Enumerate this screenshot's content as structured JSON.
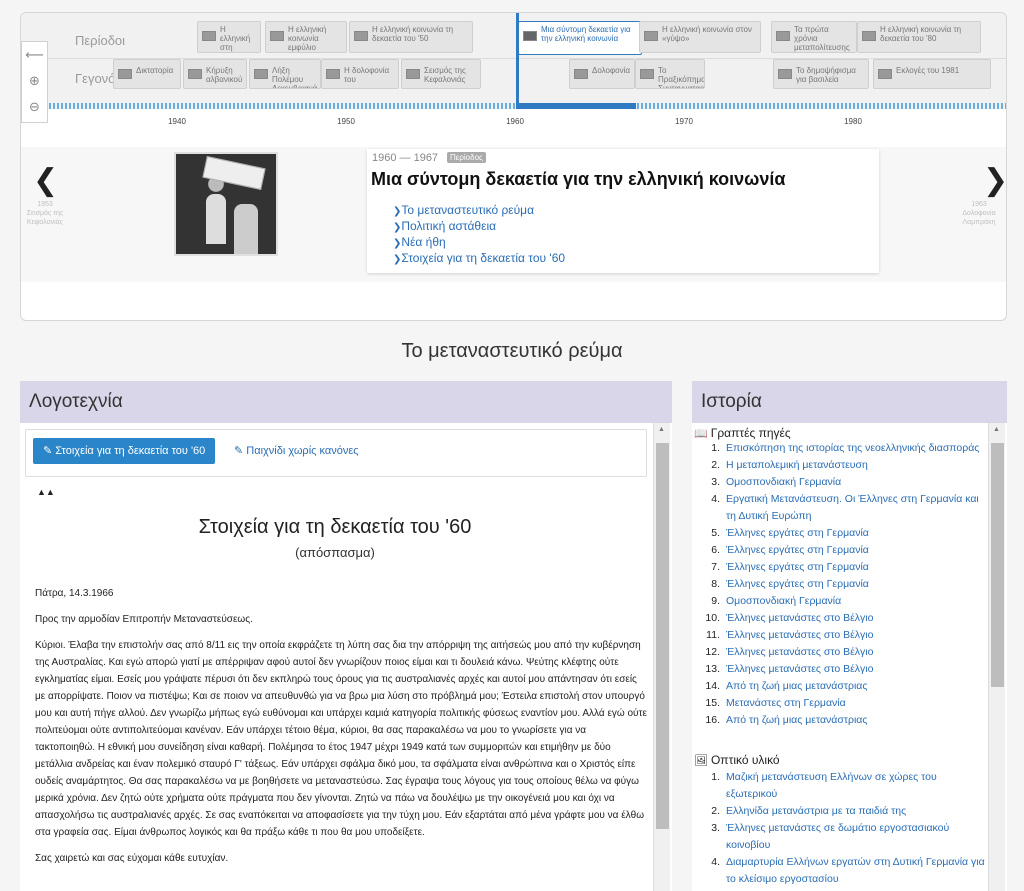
{
  "timeline": {
    "band_periods_label": "Περίοδοι",
    "band_events_label": "Γεγονό",
    "zoom_controls": [
      "back-arrow-icon",
      "zoom-in-icon",
      "zoom-out-icon"
    ],
    "period_items": [
      "Η ελληνική στη Γερμανία",
      "Η ελληνική κοινωνία εμφύλιο",
      "Η ελληνική κοινωνία τη δεκαετία του '50",
      "Μια σύντομη δεκαετία για την ελληνική κοινωνία",
      "Η ελληνική κοινωνία στον «γύψο»",
      "Τα πρώτα χρόνια μεταπολίτευσης",
      "Η ελληνική κοινωνία τη δεκαετία του '80"
    ],
    "event_items": [
      "Δικτατορία",
      "Κήρυξη αλβανικού",
      "Λήξη Πολέμου Δεκεμβριανά",
      "Η δολοφονία του",
      "Σεισμός της Κεφαλονιάς",
      "Δολοφονία",
      "Το Πραξικόπημα Συνταγματαρχών",
      "Το δημοψήφισμα για βασιλεία",
      "Εκλογές του 1981"
    ],
    "years": [
      "1940",
      "1950",
      "1960",
      "1970",
      "1980"
    ],
    "prev": {
      "year": "1953",
      "label": "Σεισμός της Κεφαλονιάς"
    },
    "next": {
      "year": "1963",
      "label": "Δολοφονία Λαμπράκη"
    },
    "active": {
      "period": "1960 — 1967",
      "badge": "Περίοδος",
      "title": "Μια σύντομη δεκαετία για την ελληνική κοινωνία",
      "links": [
        "Το μεταναστευτικό ρεύμα",
        "Πολιτική αστάθεια",
        "Νέα ήθη",
        "Στοιχεία για τη δεκαετία του '60"
      ]
    }
  },
  "section_title": "Το μεταναστευτικό ρεύμα",
  "literature": {
    "heading": "Λογοτεχνία",
    "primary_button": "Στοιχεία για τη δεκαετία του '60",
    "secondary_link": "Παιχνίδι χωρίς κανόνες",
    "doc_title": "Στοιχεία για τη δεκαετία του '60",
    "doc_subtitle": "(απόσπασμα)",
    "paragraphs": [
      "Πάτρα, 14.3.1966",
      "Προς την αρμοδίαν Επιτροπήν Μεταναστεύσεως.",
      "Κύριοι. Έλαβα την επιστολήν σας από 8/11 εις την οποία εκφράζετε τη λύπη σας δια την απόρριψη της αιτήσεώς μου από την κυβέρνηση της Αυστραλίας. Και εγώ απορώ γιατί με απέρριψαν αφού αυτοί δεν γνωρίζουν ποιος είμαι και τι δουλειά κάνω. Ψεύτης κλέφτης ούτε εγκληματίας είμαι. Εσείς μου γράψατε πέρυσι ότι δεν εκπληρώ τους όρους για τις αυστραλιανές αρχές και αυτοί μου απάντησαν ότι εσείς με απορρίψατε. Ποιον να πιστέψω; Και σε ποιον να απευθυνθώ για να βρω μια λύση στο πρόβλημά μου; Έστειλα επιστολή στον υπουργό μου και αυτή πήγε αλλού. Δεν γνωρίζω μήπως εγώ ευθύνομαι και υπάρχει καμιά κατηγορία πολιτικής φύσεως εναντίον μου. Αλλά εγώ ούτε πολιτεύομαι ούτε αντιπολιτεύομαι κανέναν. Εάν υπάρχει τέτοιο θέμα, κύριοι, θα σας παρακαλέσω να μου το γνωρίσετε για να τακτοποιηθώ. Η εθνική μου συνείδηση είναι καθαρή. Πολέμησα το έτος 1947 μέχρι 1949 κατά των συμμοριτών και ετιμήθην με δύο μετάλλια ανδρείας και έναν πολεμικό σταυρό Γ' τάξεως. Εάν υπάρχει σφάλμα δικό μου, τα σφάλματα είναι ανθρώπινα και ο Χριστός είπε ουδείς αναμάρτητος. Θα σας παρακαλέσω να με βοηθήσετε να μεταναστεύσω. Σας έγραψα τους λόγους για τους οποίους θέλω να φύγω μερικά χρόνια. Δεν ζητώ ούτε χρήματα ούτε πράγματα που δεν γίνονται. Ζητώ να πάω να δουλέψω με την οικογένειά μου και όχι να απασχολήσω τις αυστραλιανές αρχές. Σε σας εναπόκειται να αποφασίσετε για την τύχη μου. Εάν εξαρτάται από μένα γράφτε μου να έλθω στα γραφεία σας. Είμαι άνθρωπος λογικός και θα πράξω κάθε τι που θα μου υποδείξετε.",
      "Σας χαιρετώ και σας εύχομαι κάθε ευτυχίαν."
    ]
  },
  "history": {
    "heading": "Ιστορία",
    "written_heading": "Γραπτές πηγές",
    "written_sources": [
      "Επισκόπηση της ιστορίας της νεοελληνικής διασποράς",
      "Η μεταπολεμική μετανάστευση",
      "Ομοσπονδιακή Γερμανία",
      "Εργατική Μετανάστευση. Οι Έλληνες στη Γερμανία και τη Δυτική Ευρώπη",
      "Έλληνες εργάτες στη Γερμανία",
      "Έλληνες εργάτες στη Γερμανία",
      "Έλληνες εργάτες στη Γερμανία",
      "Έλληνες εργάτες στη Γερμανία",
      "Ομοσπονδιακή Γερμανία",
      "Έλληνες μετανάστες στο Βέλγιο",
      "Έλληνες μετανάστες στο Βέλγιο",
      "Έλληνες μετανάστες στο Βέλγιο",
      "Έλληνες μετανάστες στο Βέλγιο",
      "Από τη ζωή μιας μετανάστριας",
      "Μετανάστες στη Γερμανία",
      "Από τη ζωή μιας μετανάστριας"
    ],
    "visual_heading": "Οπτικό υλικό",
    "visual_sources": [
      "Μαζική μετανάστευση Ελλήνων σε χώρες του εξωτερικού",
      "Ελληνίδα μετανάστρια με τα παιδιά της",
      "Έλληνες μετανάστες σε δωμάτιο εργοστασιακού κοινοβίου",
      "Διαμαρτυρία Ελλήνων εργατών στη Δυτική Γερμανία για το κλείσιμο εργοστασίου"
    ]
  },
  "colors": {
    "accent": "#2a85c9",
    "link": "#2a6db5",
    "panel_header": "#d8d6e8"
  }
}
